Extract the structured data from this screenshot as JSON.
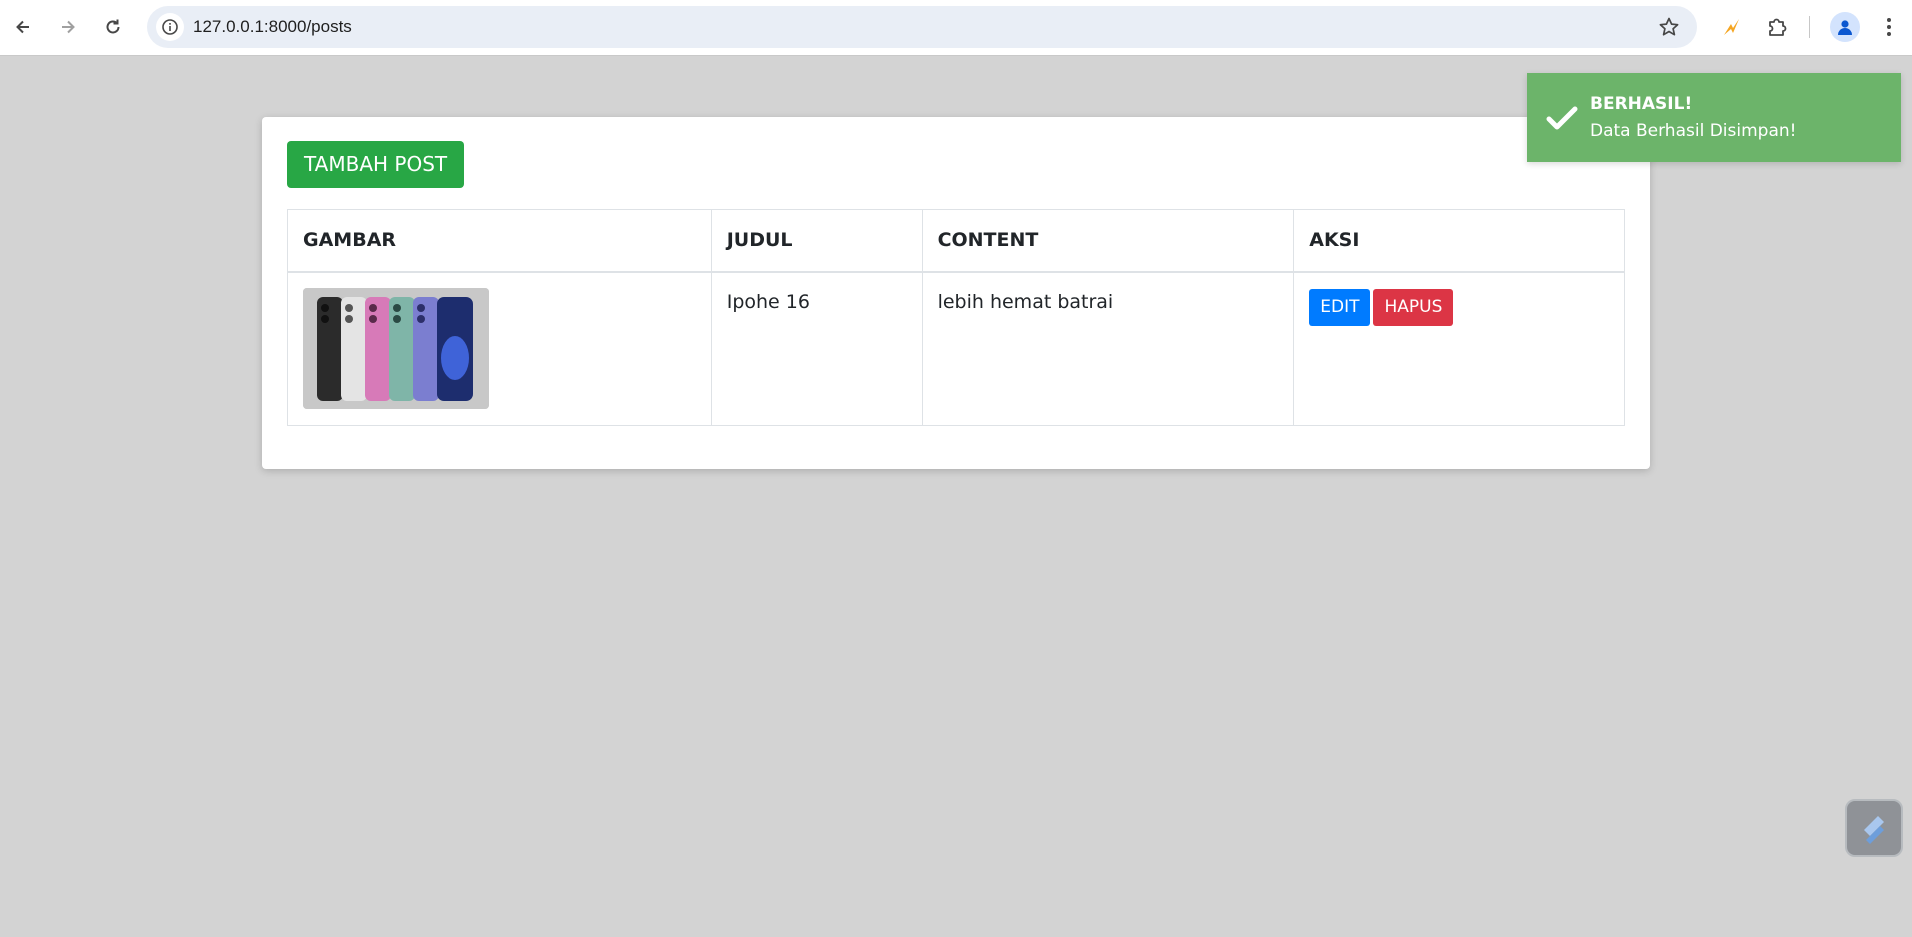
{
  "browser": {
    "url": "127.0.0.1:8000/posts",
    "icons": [
      "back-arrow-icon",
      "forward-arrow-icon",
      "reload-icon",
      "site-info-icon",
      "bookmark-star-icon",
      "extension-lightning-icon",
      "extensions-puzzle-icon",
      "profile-avatar-icon",
      "more-vert-icon"
    ]
  },
  "page": {
    "add_button_label": "TAMBAH POST",
    "table": {
      "headers": [
        "GAMBAR",
        "JUDUL",
        "CONTENT",
        "AKSI"
      ],
      "rows": [
        {
          "image_alt": "iPhone color lineup",
          "judul": "Ipohe 16",
          "content": "lebih hemat batrai",
          "edit_label": "EDIT",
          "delete_label": "HAPUS"
        }
      ]
    }
  },
  "toast": {
    "title": "BERHASIL!",
    "message": "Data Berhasil Disimpan!"
  },
  "colors": {
    "success": "#28a745",
    "primary": "#007bff",
    "danger": "#dc3545",
    "toast_bg": "#6cb46a",
    "page_bg": "#d3d3d3"
  }
}
